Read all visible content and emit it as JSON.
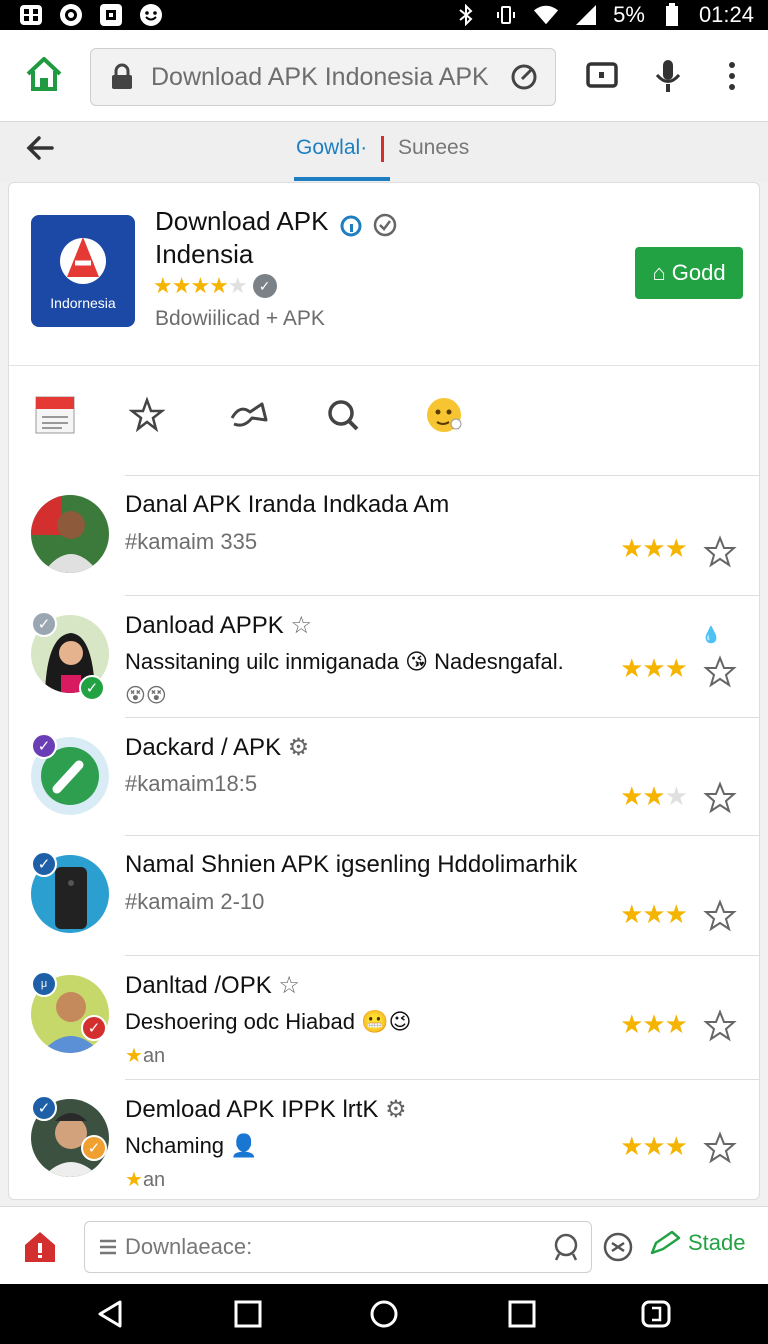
{
  "status": {
    "battery": "5%",
    "time": "01:24"
  },
  "browser": {
    "url_text": "Download APK Indonesia APK"
  },
  "tabs": [
    {
      "label": "Gowlal·"
    },
    {
      "label": "Sunees"
    }
  ],
  "app": {
    "title_line1": "Download APK",
    "title_line2": "Indensia",
    "icon_tag": "Indornesia",
    "rating": 4,
    "subtitle": "Bdowiilicad + APK",
    "action_label": "Godd"
  },
  "list": [
    {
      "title": "Danal APK Iranda Indkada Am",
      "sub": "#kamaim 335",
      "sub2": "",
      "rating": 3,
      "emoji": ""
    },
    {
      "title": "Danload APPK",
      "sub": "Nassitaning uilc inmiganada",
      "sub_tail": "Nadesngafal.",
      "sub2": "😵😵",
      "rating": 3,
      "emoji": "😘"
    },
    {
      "title": "Dackard / APK",
      "sub": "#kamaim18:5",
      "sub2": "",
      "rating": 2,
      "emoji": ""
    },
    {
      "title": "Namal Shnien APK igsenling Hddolimarhik",
      "sub": "#kamaim 2-10",
      "sub2": "",
      "rating": 3,
      "emoji": ""
    },
    {
      "title": "Danltad /OPK",
      "sub": "Deshoering odc Hiabad",
      "sub2": "an",
      "rating": 3,
      "emoji": "😬😉"
    },
    {
      "title": "Demload APK IPPK lrtK",
      "sub": "Nchaming",
      "sub2": "an",
      "rating": 3,
      "emoji": ""
    }
  ],
  "bottom": {
    "search_placeholder": "Downlaeace:",
    "action_label": "Stade"
  },
  "colors": {
    "accent_green": "#23a244",
    "tab_blue": "#1d7fc1",
    "star": "#f5b400"
  }
}
